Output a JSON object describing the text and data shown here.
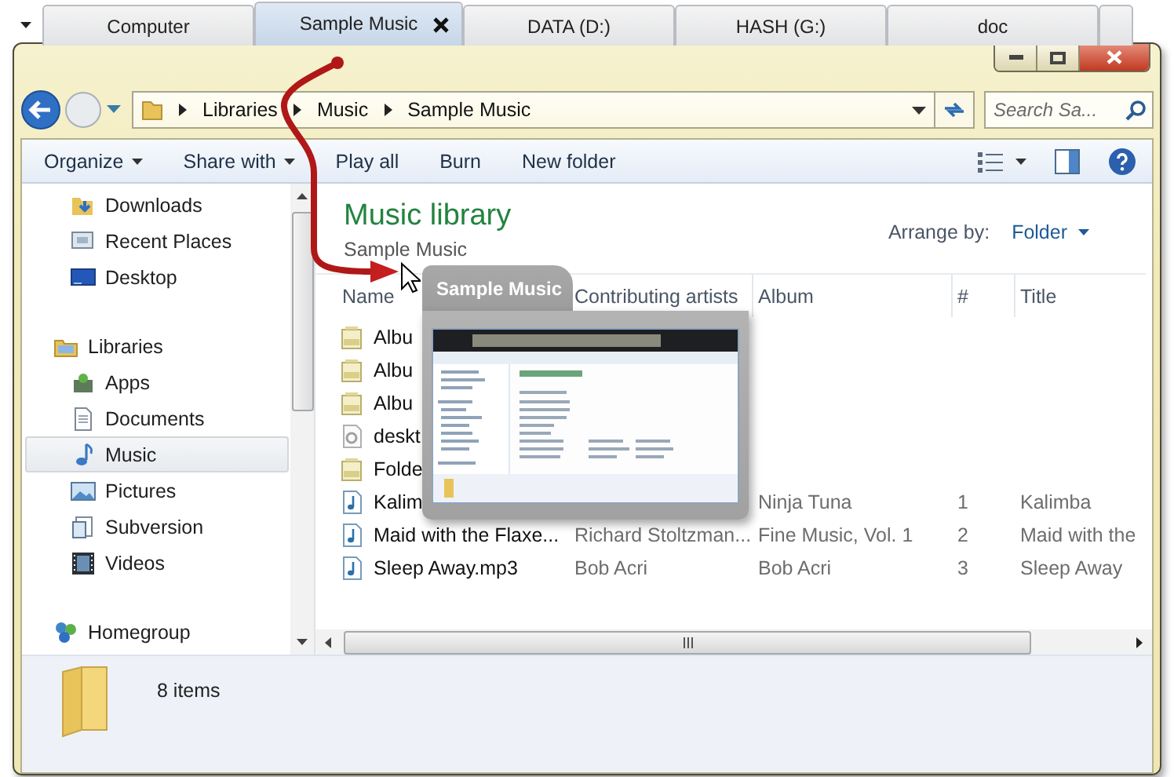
{
  "tab_strip": {
    "tabs": [
      {
        "label": "Computer",
        "selected": false
      },
      {
        "label": "Sample Music",
        "selected": true
      },
      {
        "label": "DATA (D:)",
        "selected": false
      },
      {
        "label": "HASH (G:)",
        "selected": false
      },
      {
        "label": "doc",
        "selected": false
      }
    ]
  },
  "address_bar": {
    "path": [
      "Libraries",
      "Music",
      "Sample Music"
    ]
  },
  "search": {
    "placeholder": "Search Sa..."
  },
  "toolbar": {
    "buttons": [
      {
        "label": "Organize",
        "dropdown": true
      },
      {
        "label": "Share with",
        "dropdown": true
      },
      {
        "label": "Play all",
        "dropdown": false
      },
      {
        "label": "Burn",
        "dropdown": false
      },
      {
        "label": "New folder",
        "dropdown": false
      }
    ]
  },
  "nav_pane": {
    "favorites": [
      {
        "label": "Downloads",
        "kind": "downloads",
        "selected": false
      },
      {
        "label": "Recent Places",
        "kind": "recent",
        "selected": false
      },
      {
        "label": "Desktop",
        "kind": "desktop",
        "selected": false
      }
    ],
    "tree": [
      {
        "label": "Libraries",
        "kind": "libraries",
        "selected": false,
        "children": [
          {
            "label": "Apps",
            "kind": "apps",
            "selected": false
          },
          {
            "label": "Documents",
            "kind": "documents",
            "selected": false
          },
          {
            "label": "Music",
            "kind": "music",
            "selected": true
          },
          {
            "label": "Pictures",
            "kind": "pictures",
            "selected": false
          },
          {
            "label": "Subversion",
            "kind": "subversion",
            "selected": false
          },
          {
            "label": "Videos",
            "kind": "videos",
            "selected": false
          }
        ]
      },
      {
        "label": "Homegroup",
        "kind": "homegroup",
        "selected": false
      }
    ]
  },
  "library_header": {
    "title": "Music library",
    "subtitle": "Sample Music",
    "arrange_label": "Arrange by:",
    "arrange_value": "Folder"
  },
  "table": {
    "columns": [
      "Name",
      "Contributing artists",
      "Album",
      "#",
      "Title"
    ],
    "rows": [
      {
        "kind": "image",
        "name": "Albu"
      },
      {
        "kind": "image",
        "name": "Albu"
      },
      {
        "kind": "image",
        "name": "Albu"
      },
      {
        "kind": "settings",
        "name": "deskt"
      },
      {
        "kind": "image",
        "name": "Folde"
      },
      {
        "kind": "audio",
        "name": "Kalim",
        "album": "Ninja Tuna",
        "number": "1",
        "title": "Kalimba"
      },
      {
        "kind": "audio",
        "name": "Maid with the Flaxe...",
        "artists": "Richard Stoltzman...",
        "album": "Fine Music, Vol. 1",
        "number": "2",
        "title": "Maid with the"
      },
      {
        "kind": "audio",
        "name": "Sleep Away.mp3",
        "artists": "Bob Acri",
        "album": "Bob Acri",
        "number": "3",
        "title": "Sleep Away"
      }
    ]
  },
  "preview": {
    "title": "Sample Music"
  },
  "status_bar": {
    "text": "8 items"
  }
}
